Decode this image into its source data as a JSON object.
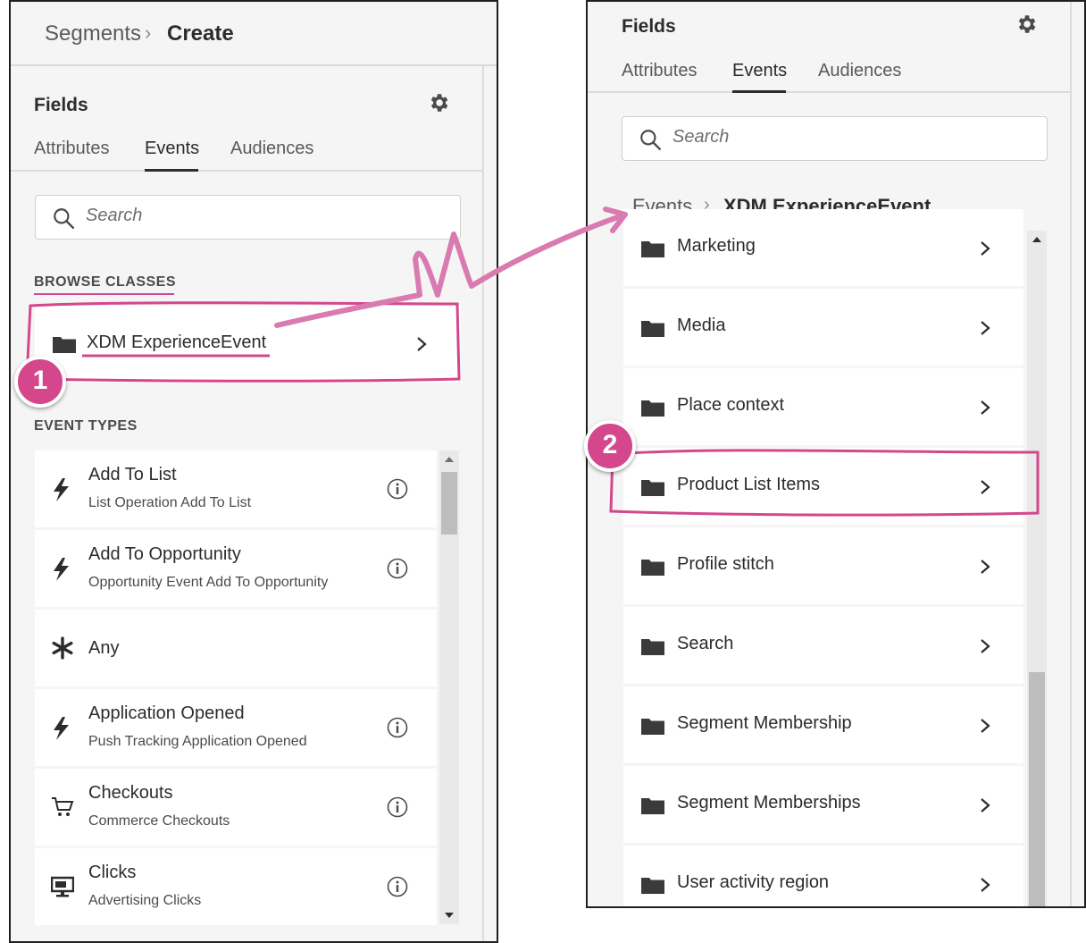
{
  "left": {
    "breadcrumb": {
      "parent": "Segments",
      "separator": "›",
      "current": "Create"
    },
    "fields_title": "Fields",
    "tabs": [
      "Attributes",
      "Events",
      "Audiences"
    ],
    "active_tab": "Events",
    "search_placeholder": "Search",
    "browse_classes_label": "BROWSE CLASSES",
    "class_item": "XDM ExperienceEvent",
    "event_types_label": "EVENT TYPES",
    "events": [
      {
        "title": "Add To List",
        "subtitle": "List Operation Add To List",
        "icon": "lightning-icon"
      },
      {
        "title": "Add To Opportunity",
        "subtitle": "Opportunity Event Add To Opportunity",
        "icon": "lightning-icon"
      },
      {
        "title": "Any",
        "subtitle": "",
        "icon": "asterisk-icon"
      },
      {
        "title": "Application Opened",
        "subtitle": "Push Tracking Application Opened",
        "icon": "lightning-icon"
      },
      {
        "title": "Checkouts",
        "subtitle": "Commerce Checkouts",
        "icon": "cart-icon"
      },
      {
        "title": "Clicks",
        "subtitle": "Advertising Clicks",
        "icon": "monitor-icon"
      }
    ]
  },
  "right": {
    "fields_title": "Fields",
    "tabs": [
      "Attributes",
      "Events",
      "Audiences"
    ],
    "active_tab": "Events",
    "search_placeholder": "Search",
    "breadcrumb": {
      "parent": "Events",
      "separator": "›",
      "current": "XDM ExperienceEvent"
    },
    "items": [
      "Marketing",
      "Media",
      "Place context",
      "Product List Items",
      "Profile stitch",
      "Search",
      "Segment Membership",
      "Segment Memberships",
      "User activity region"
    ]
  },
  "annotations": {
    "badge1": "1",
    "badge2": "2",
    "accent_color": "#d4478c"
  }
}
